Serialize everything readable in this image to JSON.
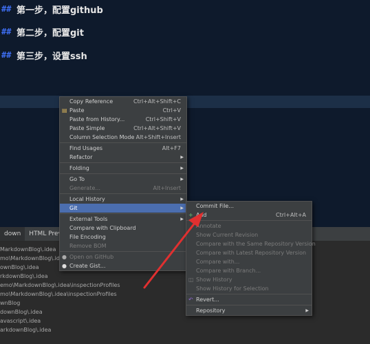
{
  "editor": {
    "lines": [
      {
        "hash": "##",
        "text": "第一步，配置github"
      },
      {
        "hash": "##",
        "text": "第二步，配置git"
      },
      {
        "hash": "##",
        "text": "第三步，设置ssh"
      }
    ]
  },
  "tool_tabs": [
    "down",
    "HTML Preview"
  ],
  "files": [
    "MarkdownBlog\\.idea",
    "mo\\MarkdownBlog\\.idea",
    "ownBlog\\.idea",
    "rkdownBlog\\.idea",
    "emo\\MarkdownBlog\\.idea\\inspectionProfiles",
    "mo\\MarkdownBlog\\.idea\\inspectionProfiles",
    "wnBlog",
    "downBlog\\.idea",
    "avascript\\.idea",
    "arkdownBlog\\.idea"
  ],
  "context_menu": [
    {
      "label": "Copy Reference",
      "shortcut": "Ctrl+Alt+Shift+C"
    },
    {
      "label": "Paste",
      "shortcut": "Ctrl+V",
      "icon": "paste-icon"
    },
    {
      "label": "Paste from History...",
      "shortcut": "Ctrl+Shift+V"
    },
    {
      "label": "Paste Simple",
      "shortcut": "Ctrl+Alt+Shift+V"
    },
    {
      "label": "Column Selection Mode",
      "shortcut": "Alt+Shift+Insert"
    },
    {
      "label": "Find Usages",
      "shortcut": "Alt+F7"
    },
    {
      "label": "Refactor",
      "submenu": true
    },
    {
      "label": "Folding",
      "submenu": true
    },
    {
      "label": "Go To",
      "submenu": true
    },
    {
      "label": "Generate...",
      "shortcut": "Alt+Insert"
    },
    {
      "label": "Local History",
      "submenu": true
    },
    {
      "label": "Git",
      "submenu": true
    },
    {
      "label": "External Tools",
      "submenu": true
    },
    {
      "label": "Compare with Clipboard"
    },
    {
      "label": "File Encoding"
    },
    {
      "label": "Remove BOM"
    },
    {
      "label": "Open on GitHub"
    },
    {
      "label": "Create Gist..."
    }
  ],
  "git_submenu": [
    {
      "label": "Commit File..."
    },
    {
      "label": "Add",
      "shortcut": "Ctrl+Alt+A",
      "icon": "add-icon"
    },
    {
      "label": "Annotate"
    },
    {
      "label": "Show Current Revision"
    },
    {
      "label": "Compare with the Same Repository Version"
    },
    {
      "label": "Compare with Latest Repository Version"
    },
    {
      "label": "Compare with..."
    },
    {
      "label": "Compare with Branch..."
    },
    {
      "label": "Show History"
    },
    {
      "label": "Show History for Selection"
    },
    {
      "label": "Revert..."
    },
    {
      "label": "Repository"
    }
  ],
  "colors": {
    "accent": "#4b6eaf",
    "arrow": "#e03030",
    "bg": "#0e1a2c"
  }
}
